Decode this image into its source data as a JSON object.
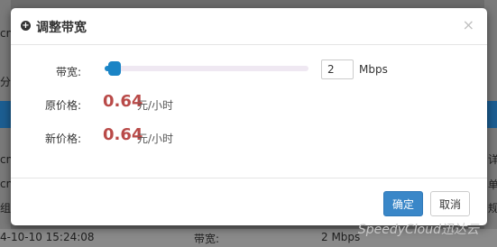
{
  "background": {
    "fragments": [
      "cn",
      "分组",
      "cn",
      "cn",
      "组",
      "4-10-10 15:24:08",
      "带宽:",
      "2 Mbps",
      "详",
      "单",
      "规"
    ]
  },
  "modal": {
    "title": "调整带宽",
    "close": "×",
    "bandwidth_label": "带宽:",
    "bandwidth_value": "2",
    "bandwidth_unit": "Mbps",
    "slider_percent": 5,
    "original_price_label": "原价格:",
    "original_price": "0.64",
    "original_price_unit": "元/小时",
    "new_price_label": "新价格:",
    "new_price": "0.64",
    "new_price_unit": "元/小时",
    "ok_label": "确定",
    "cancel_label": "取消"
  },
  "watermark": "SpeedyCloud迅达云",
  "colors": {
    "accent": "#1a84c5",
    "price": "#b94a48",
    "primary_button": "#3a87c8"
  }
}
